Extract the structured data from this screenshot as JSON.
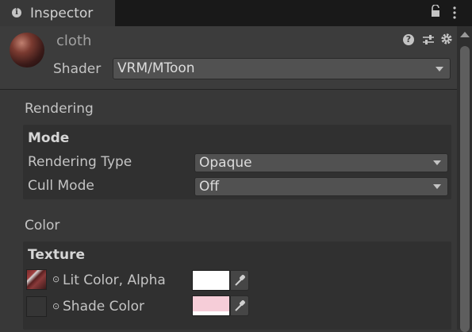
{
  "window": {
    "tab_title": "Inspector"
  },
  "material": {
    "name": "cloth",
    "shader_label": "Shader",
    "shader_value": "VRM/MToon"
  },
  "rendering": {
    "title": "Rendering",
    "mode_title": "Mode",
    "rendering_type_label": "Rendering Type",
    "rendering_type_value": "Opaque",
    "cull_mode_label": "Cull Mode",
    "cull_mode_value": "Off"
  },
  "color": {
    "title": "Color",
    "texture_title": "Texture",
    "lit_label": "Lit Color, Alpha",
    "shade_label": "Shade Color",
    "lit_color": "#ffffff",
    "shade_color": "#f6cdd8"
  },
  "icons": {
    "info": "info-icon",
    "lock": "lock-icon",
    "menu": "kebab-menu-icon",
    "help": "help-icon",
    "presets": "presets-icon",
    "settings": "gear-icon",
    "eyedropper": "eyedropper-icon",
    "texture_picker": "object-picker-icon"
  }
}
